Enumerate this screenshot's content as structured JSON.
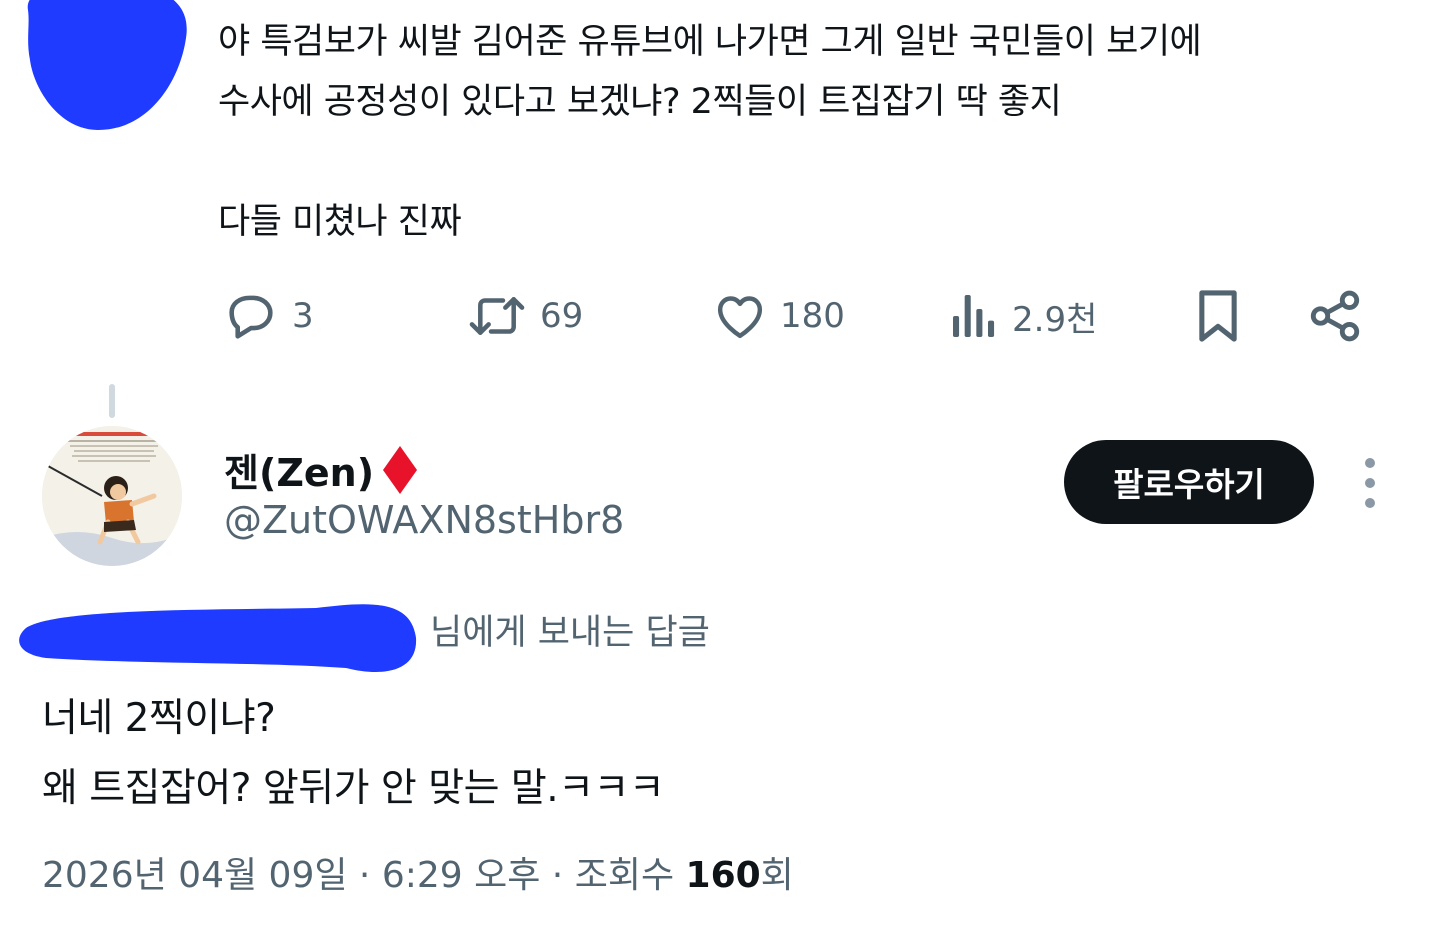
{
  "parent_tweet": {
    "text": "야 특검보가 씨발 김어준 유튜브에 나가면 그게 일반 국민들이 보기에\n수사에 공정성이 있다고 보겠냐? 2찍들이 트집잡기 딱 좋지\n\n다들 미쳤나 진짜",
    "avatar_redaction_color": "#1e3bff",
    "actions": {
      "reply_icon": "reply-bubble-icon",
      "reply_count": "3",
      "retweet_icon": "retweet-icon",
      "retweet_count": "69",
      "like_icon": "heart-icon",
      "like_count": "180",
      "views_icon": "bar-chart-icon",
      "views_count": "2.9천",
      "bookmark_icon": "bookmark-icon",
      "share_icon": "share-icon"
    }
  },
  "reply": {
    "author": {
      "display_name": "젠(Zen)",
      "badge_icon": "red-diamond-icon",
      "handle": "@ZutOWAXN8stHbr8"
    },
    "follow_label": "팔로우하기",
    "more_icon": "more-vertical-icon",
    "replying_to_suffix": "님에게 보내는 답글",
    "replying_redaction_color": "#1e3bff",
    "text": "너네 2찍이냐?\n왜 트집잡어? 앞뒤가 안 맞는 말.ㅋㅋㅋ",
    "meta": {
      "date": "2026년 04월 09일",
      "separator": " · ",
      "time": "6:29 오후",
      "views_label": "조회수 ",
      "views_count": "160",
      "views_suffix": "회"
    }
  },
  "colors": {
    "text_primary": "#0f1419",
    "text_secondary": "#536471",
    "follow_button_bg": "#0f1419",
    "badge_red": "#e8132a"
  }
}
